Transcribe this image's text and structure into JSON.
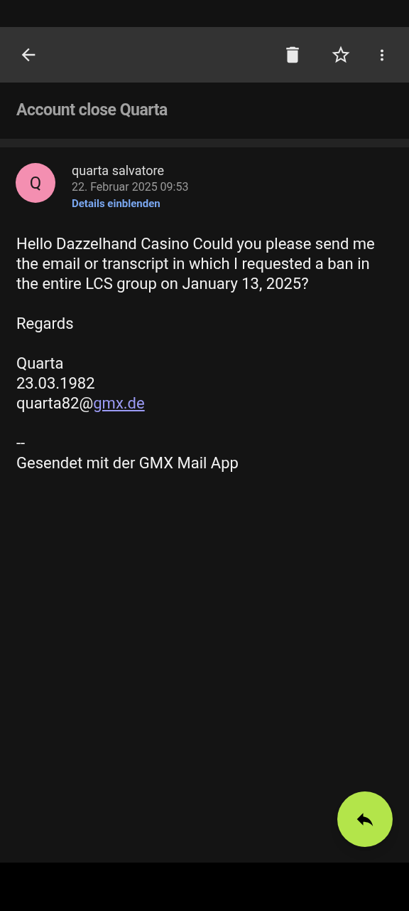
{
  "subject": "Account close Quarta",
  "sender": {
    "initial": "Q",
    "color": "#f48fb1",
    "name": "quarta salvatore",
    "date": "22. Februar 2025 09:53",
    "details_link": "Details einblenden"
  },
  "body": [
    {
      "lines": [
        {
          "kind": "text",
          "text": "Hello Dazzelhand Casino Could you please send me the email or transcript in which I requested a ban in the entire LCS group on January 13, 2025?"
        }
      ]
    },
    {
      "lines": [
        {
          "kind": "text",
          "text": "Regards"
        }
      ]
    },
    {
      "lines": [
        {
          "kind": "text",
          "text": "Quarta"
        },
        {
          "kind": "text",
          "text": "23.03.1982"
        },
        {
          "kind": "email",
          "text": "quarta82@",
          "link": "gmx.de"
        }
      ]
    },
    {
      "lines": [
        {
          "kind": "text",
          "text": "--"
        },
        {
          "kind": "text",
          "text": "Gesendet mit der GMX Mail App"
        }
      ]
    }
  ]
}
